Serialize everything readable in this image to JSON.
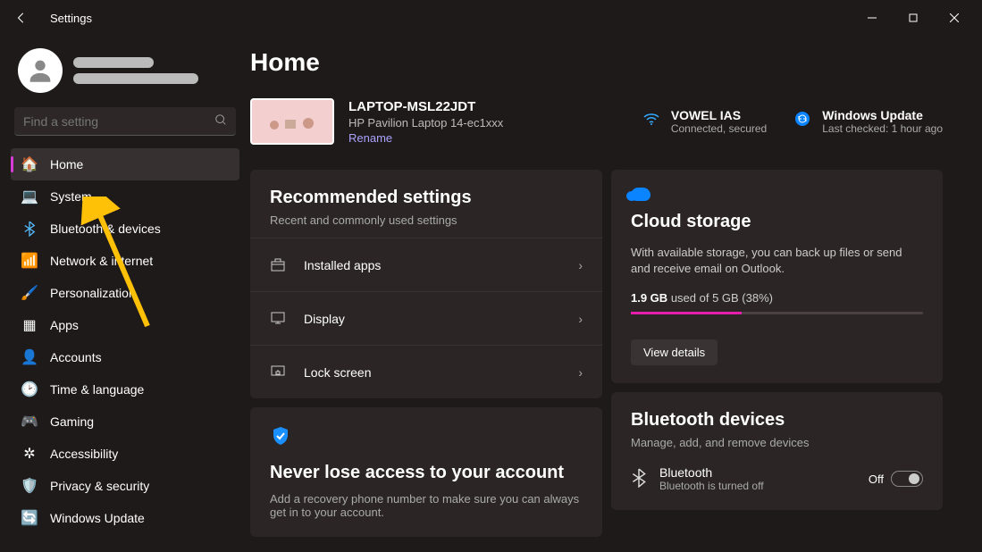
{
  "titlebar": {
    "title": "Settings"
  },
  "search": {
    "placeholder": "Find a setting"
  },
  "nav": {
    "items": [
      {
        "label": "Home",
        "icon": "🏠",
        "active": true
      },
      {
        "label": "System",
        "icon": "💻"
      },
      {
        "label": "Bluetooth & devices",
        "icon": "bt"
      },
      {
        "label": "Network & internet",
        "icon": "📶"
      },
      {
        "label": "Personalization",
        "icon": "🖌️"
      },
      {
        "label": "Apps",
        "icon": "▦"
      },
      {
        "label": "Accounts",
        "icon": "👤"
      },
      {
        "label": "Time & language",
        "icon": "🕑"
      },
      {
        "label": "Gaming",
        "icon": "🎮"
      },
      {
        "label": "Accessibility",
        "icon": "✲"
      },
      {
        "label": "Privacy & security",
        "icon": "🛡️"
      },
      {
        "label": "Windows Update",
        "icon": "🔄"
      }
    ]
  },
  "page": {
    "title": "Home"
  },
  "device": {
    "name": "LAPTOP-MSL22JDT",
    "model": "HP Pavilion Laptop 14-ec1xxx",
    "rename": "Rename"
  },
  "wifi": {
    "name": "VOWEL IAS",
    "status": "Connected, secured"
  },
  "update": {
    "name": "Windows Update",
    "status": "Last checked: 1 hour ago"
  },
  "recommended": {
    "title": "Recommended settings",
    "sub": "Recent and commonly used settings",
    "items": [
      {
        "label": "Installed apps"
      },
      {
        "label": "Display"
      },
      {
        "label": "Lock screen"
      }
    ]
  },
  "recovery": {
    "title": "Never lose access to your account",
    "sub": "Add a recovery phone number to make sure you can always get in to your account."
  },
  "cloud": {
    "title": "Cloud storage",
    "desc": "With available storage, you can back up files or send and receive email on Outlook.",
    "used": "1.9 GB",
    "total": "used of 5 GB (38%)",
    "percent": 38,
    "btn": "View details"
  },
  "bluetooth": {
    "title": "Bluetooth devices",
    "sub": "Manage, add, and remove devices",
    "item_name": "Bluetooth",
    "item_status": "Bluetooth is turned off",
    "toggle_state": "Off"
  }
}
